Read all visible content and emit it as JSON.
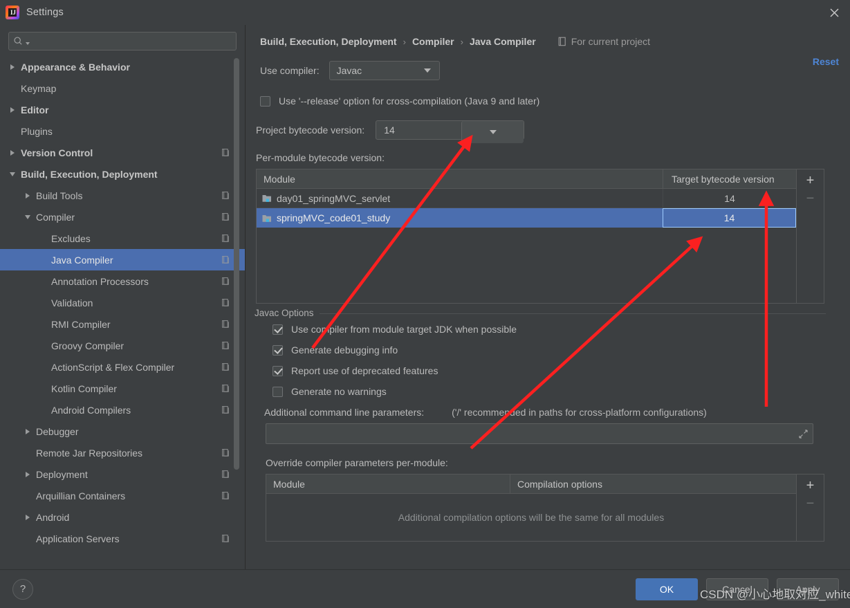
{
  "window": {
    "title": "Settings",
    "app_icon": "intellij-idea-icon",
    "close_icon": "close-icon"
  },
  "search": {
    "placeholder": "",
    "value": "",
    "icon": "search-icon"
  },
  "sidebar": {
    "items": [
      {
        "label": "Appearance & Behavior",
        "indent": 0,
        "arrow": "closed",
        "bold": true,
        "copy": false,
        "selected": false
      },
      {
        "label": "Keymap",
        "indent": 0,
        "arrow": "none",
        "bold": false,
        "copy": false,
        "selected": false
      },
      {
        "label": "Editor",
        "indent": 0,
        "arrow": "closed",
        "bold": true,
        "copy": false,
        "selected": false
      },
      {
        "label": "Plugins",
        "indent": 0,
        "arrow": "none",
        "bold": false,
        "copy": false,
        "selected": false
      },
      {
        "label": "Version Control",
        "indent": 0,
        "arrow": "closed",
        "bold": true,
        "copy": true,
        "selected": false
      },
      {
        "label": "Build, Execution, Deployment",
        "indent": 0,
        "arrow": "open",
        "bold": true,
        "copy": false,
        "selected": false
      },
      {
        "label": "Build Tools",
        "indent": 1,
        "arrow": "closed",
        "bold": false,
        "copy": true,
        "selected": false
      },
      {
        "label": "Compiler",
        "indent": 1,
        "arrow": "open",
        "bold": false,
        "copy": true,
        "selected": false
      },
      {
        "label": "Excludes",
        "indent": 2,
        "arrow": "none",
        "bold": false,
        "copy": true,
        "selected": false
      },
      {
        "label": "Java Compiler",
        "indent": 2,
        "arrow": "none",
        "bold": false,
        "copy": true,
        "selected": true
      },
      {
        "label": "Annotation Processors",
        "indent": 2,
        "arrow": "none",
        "bold": false,
        "copy": true,
        "selected": false
      },
      {
        "label": "Validation",
        "indent": 2,
        "arrow": "none",
        "bold": false,
        "copy": true,
        "selected": false
      },
      {
        "label": "RMI Compiler",
        "indent": 2,
        "arrow": "none",
        "bold": false,
        "copy": true,
        "selected": false
      },
      {
        "label": "Groovy Compiler",
        "indent": 2,
        "arrow": "none",
        "bold": false,
        "copy": true,
        "selected": false
      },
      {
        "label": "ActionScript & Flex Compiler",
        "indent": 2,
        "arrow": "none",
        "bold": false,
        "copy": true,
        "selected": false
      },
      {
        "label": "Kotlin Compiler",
        "indent": 2,
        "arrow": "none",
        "bold": false,
        "copy": true,
        "selected": false
      },
      {
        "label": "Android Compilers",
        "indent": 2,
        "arrow": "none",
        "bold": false,
        "copy": true,
        "selected": false
      },
      {
        "label": "Debugger",
        "indent": 1,
        "arrow": "closed",
        "bold": false,
        "copy": false,
        "selected": false
      },
      {
        "label": "Remote Jar Repositories",
        "indent": 1,
        "arrow": "none",
        "bold": false,
        "copy": true,
        "selected": false
      },
      {
        "label": "Deployment",
        "indent": 1,
        "arrow": "closed",
        "bold": false,
        "copy": true,
        "selected": false
      },
      {
        "label": "Arquillian Containers",
        "indent": 1,
        "arrow": "none",
        "bold": false,
        "copy": true,
        "selected": false
      },
      {
        "label": "Android",
        "indent": 1,
        "arrow": "closed",
        "bold": false,
        "copy": false,
        "selected": false
      },
      {
        "label": "Application Servers",
        "indent": 1,
        "arrow": "none",
        "bold": false,
        "copy": true,
        "selected": false
      }
    ]
  },
  "breadcrumb": {
    "crumb1": "Build, Execution, Deployment",
    "crumb2": "Compiler",
    "crumb3": "Java Compiler",
    "separator": "›",
    "scope_label": "For current project",
    "scope_icon": "project-scope-icon",
    "reset_label": "Reset"
  },
  "main": {
    "use_compiler_label": "Use compiler:",
    "use_compiler_value": "Javac",
    "release_option_label": "Use '--release' option for cross-compilation (Java 9 and later)",
    "release_option_checked": false,
    "project_bytecode_label": "Project bytecode version:",
    "project_bytecode_value": "14",
    "per_module_label": "Per-module bytecode version:",
    "module_table": {
      "columns": [
        "Module",
        "Target bytecode version"
      ],
      "rows": [
        {
          "module": "day01_springMVC_servlet",
          "target": "14",
          "selected": false
        },
        {
          "module": "springMVC_code01_study",
          "target": "14",
          "selected": true
        }
      ],
      "add_label": "+",
      "remove_label": "−"
    },
    "javac_group_title": "Javac Options",
    "javac_options": [
      {
        "label": "Use compiler from module target JDK when possible",
        "checked": true
      },
      {
        "label": "Generate debugging info",
        "checked": true
      },
      {
        "label": "Report use of deprecated features",
        "checked": true
      },
      {
        "label": "Generate no warnings",
        "checked": false
      }
    ],
    "additional_params_label": "Additional command line parameters:",
    "additional_params_hint": "('/' recommended in paths for cross-platform configurations)",
    "additional_params_value": "",
    "additional_params_placeholder": "",
    "expand_icon": "expand-icon",
    "override_label": "Override compiler parameters per-module:",
    "override_table": {
      "columns": [
        "Module",
        "Compilation options"
      ],
      "empty_message": "Additional compilation options will be the same for all modules",
      "add_label": "+",
      "remove_label": "−"
    }
  },
  "footer": {
    "help_label": "?",
    "ok_label": "OK",
    "cancel_label": "Cancel",
    "apply_label": "Apply"
  },
  "watermark": {
    "text": "CSDN @小心地取对应_white"
  },
  "colors": {
    "background": "#3c3f41",
    "selection": "#4b6eaf",
    "accent_link": "#4e86d6",
    "primary_button": "#4573b5",
    "annotation_arrow": "#fb2020",
    "text": "#bbbbbb"
  }
}
